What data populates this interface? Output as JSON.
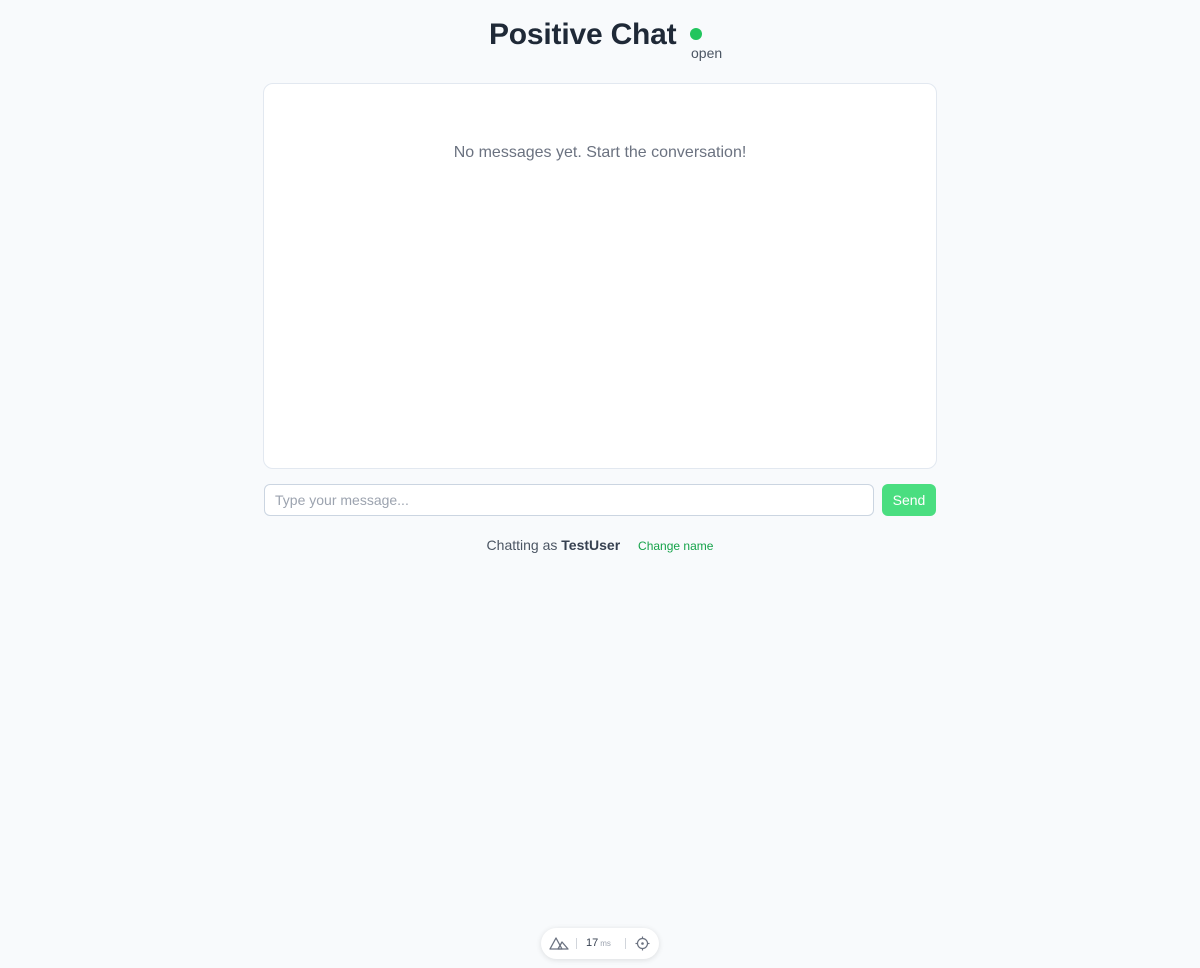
{
  "header": {
    "title": "Positive Chat",
    "status_text": "open",
    "status_color": "#22c55e"
  },
  "messages": {
    "empty_text": "No messages yet. Start the conversation!"
  },
  "composer": {
    "placeholder": "Type your message...",
    "value": "",
    "send_label": "Send",
    "accent_color": "#4ade80"
  },
  "user": {
    "prefix": "Chatting as",
    "username": "TestUser",
    "change_label": "Change name",
    "link_color": "#16a34a"
  },
  "devtools": {
    "logo_icon": "nuxt-logo-icon",
    "timing_value": "17",
    "timing_unit": "ms",
    "inspect_icon": "crosshair-icon"
  }
}
